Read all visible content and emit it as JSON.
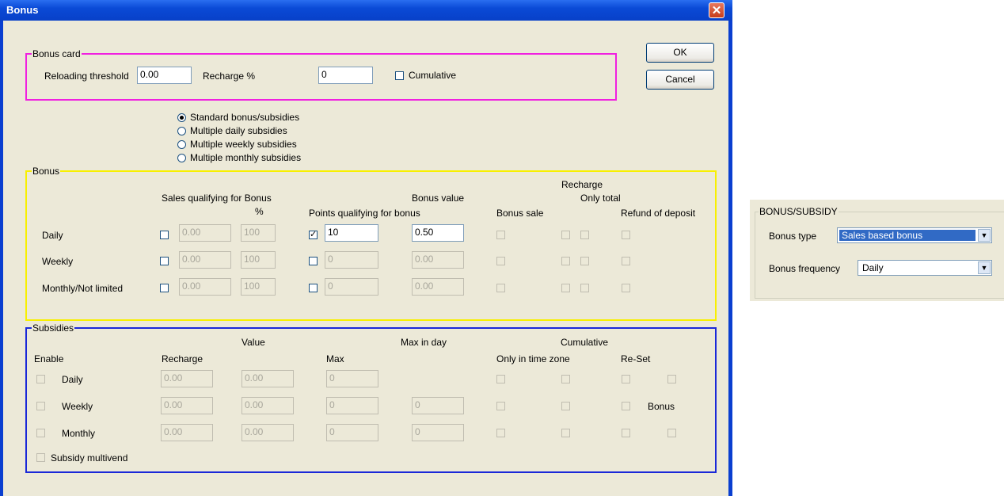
{
  "window": {
    "title": "Bonus",
    "close_glyph": "✕"
  },
  "buttons": {
    "ok": "OK",
    "cancel": "Cancel"
  },
  "bonus_card": {
    "title": "Bonus card",
    "reloading_threshold_label": "Reloading threshold",
    "reloading_threshold_value": "0.00",
    "recharge_pct_label": "Recharge %",
    "recharge_pct_value": "0",
    "cumulative_label": "Cumulative",
    "cumulative_checked": false
  },
  "mode_options": [
    {
      "label": "Standard bonus/subsidies",
      "selected": true
    },
    {
      "label": "Multiple daily subsidies",
      "selected": false
    },
    {
      "label": "Multiple weekly subsidies",
      "selected": false
    },
    {
      "label": "Multiple monthly subsidies",
      "selected": false
    }
  ],
  "bonus": {
    "title": "Bonus",
    "headers": {
      "sales_qualifying": "Sales qualifying for Bonus",
      "pct": "%",
      "points_qualifying": "Points qualifying for bonus",
      "bonus_value": "Bonus value",
      "bonus_sale": "Bonus sale",
      "recharge": "Recharge",
      "only_total": "Only total",
      "refund_of_deposit": "Refund of deposit"
    },
    "rows": [
      {
        "label": "Daily",
        "sales_value": "0.00",
        "pct_value": "100",
        "points_checked": true,
        "points_value": "10",
        "bonus_value": "0.50"
      },
      {
        "label": "Weekly",
        "sales_value": "0.00",
        "pct_value": "100",
        "points_checked": false,
        "points_value": "0",
        "bonus_value": "0.00"
      },
      {
        "label": "Monthly/Not limited",
        "sales_value": "0.00",
        "pct_value": "100",
        "points_checked": false,
        "points_value": "0",
        "bonus_value": "0.00"
      }
    ]
  },
  "subsidies": {
    "title": "Subsidies",
    "headers": {
      "enable": "Enable",
      "recharge": "Recharge",
      "value": "Value",
      "max": "Max",
      "max_in_day": "Max in day",
      "cumulative": "Cumulative",
      "only_in_time_zone": "Only in time zone",
      "reset": "Re-Set"
    },
    "rows": [
      {
        "label": "Daily",
        "recharge": "0.00",
        "value": "0.00",
        "max": "0",
        "max_in_day": null
      },
      {
        "label": "Weekly",
        "recharge": "0.00",
        "value": "0.00",
        "max": "0",
        "max_in_day": "0",
        "extra_label": "Bonus"
      },
      {
        "label": "Monthly",
        "recharge": "0.00",
        "value": "0.00",
        "max": "0",
        "max_in_day": "0"
      }
    ],
    "multivend_label": "Subsidy multivend"
  },
  "bonus_subsidy_panel": {
    "title": "BONUS/SUBSIDY",
    "bonus_type_label": "Bonus type",
    "bonus_type_value": "Sales based bonus",
    "bonus_frequency_label": "Bonus  frequency",
    "bonus_frequency_value": "Daily"
  },
  "colors": {
    "bonus_card_border": "#f020e0",
    "bonus_border": "#f8f000",
    "subsidies_border": "#1a28d8"
  }
}
